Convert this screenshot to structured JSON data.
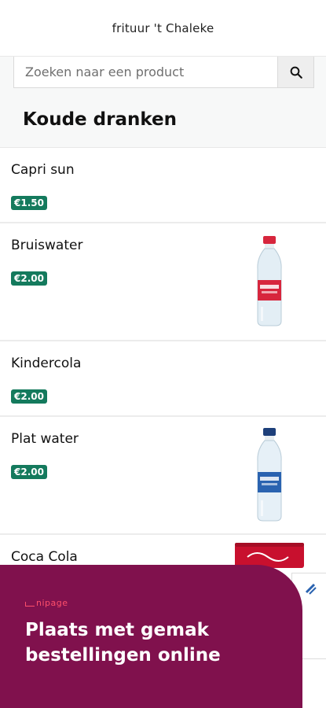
{
  "header": {
    "title": "frituur 't Chaleke"
  },
  "search": {
    "placeholder": "Zoeken naar een product",
    "icon": "search-icon"
  },
  "category": {
    "title": "Koude dranken"
  },
  "products": [
    {
      "name": "Capri sun",
      "price": "€1.50",
      "image": null
    },
    {
      "name": "Bruiswater",
      "price": "€2.00",
      "image": "sparkling-water-bottle"
    },
    {
      "name": "Kindercola",
      "price": "€2.00",
      "image": null
    },
    {
      "name": "Plat water",
      "price": "€2.00",
      "image": "still-water-bottle"
    },
    {
      "name": "Coca Cola",
      "price": "",
      "image": "coca-cola-cans"
    }
  ],
  "banner": {
    "logo": "nipage",
    "text": "Plaats met gemak bestellingen online"
  },
  "colors": {
    "price_badge": "#147a5d",
    "banner_bg": "#80114d",
    "banner_logo": "#ff4f6b"
  }
}
